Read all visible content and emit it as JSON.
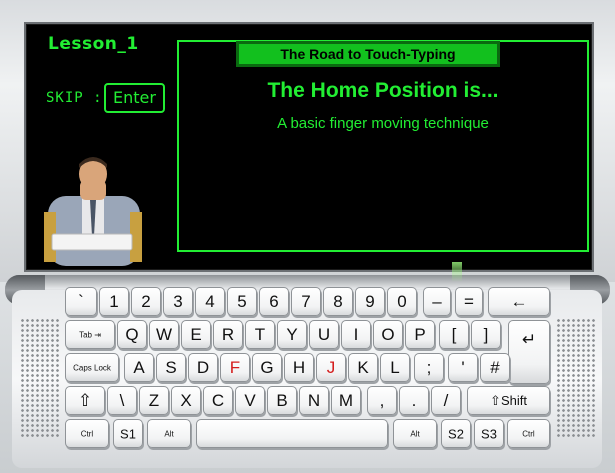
{
  "lesson": {
    "title": "Lesson_1"
  },
  "skip": {
    "label": "SKIP :",
    "button": "Enter"
  },
  "panel": {
    "header": "The Road to Touch-Typing",
    "heading": "The Home Position is...",
    "subtitle": "A basic finger moving technique"
  },
  "colors": {
    "accent": "#22ee33",
    "screen": "#000000",
    "home_key": "#d41c1c"
  },
  "keyboard": {
    "row1": [
      "`",
      "1",
      "2",
      "3",
      "4",
      "5",
      "6",
      "7",
      "8",
      "9",
      "0",
      "–",
      "=",
      "←"
    ],
    "row2": [
      "Tab ⇥",
      "Q",
      "W",
      "E",
      "R",
      "T",
      "Y",
      "U",
      "I",
      "O",
      "P",
      "[",
      "]",
      "↵"
    ],
    "row3": [
      "Caps Lock",
      "A",
      "S",
      "D",
      "F",
      "G",
      "H",
      "J",
      "K",
      "L",
      ";",
      "'",
      "#"
    ],
    "row4": [
      "⇧",
      "\\",
      "Z",
      "X",
      "C",
      "V",
      "B",
      "N",
      "M",
      ",",
      ".",
      "/",
      "⇧Shift"
    ],
    "row5": [
      "Ctrl",
      "S1",
      "Alt",
      "",
      "Alt",
      "S2",
      "S3",
      "Ctrl"
    ],
    "home_keys": [
      "F",
      "J"
    ]
  }
}
